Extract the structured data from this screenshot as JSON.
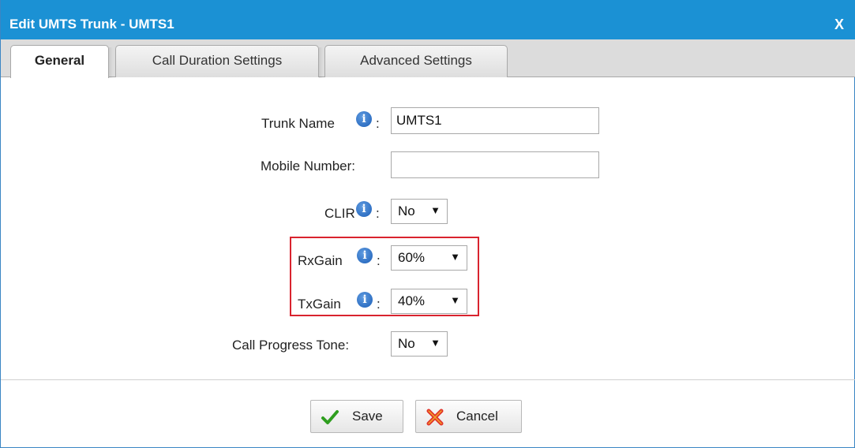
{
  "dialog": {
    "title": "Edit UMTS Trunk - UMTS1",
    "close_label": "X"
  },
  "tabs": [
    {
      "label": "General",
      "active": true
    },
    {
      "label": "Call Duration Settings",
      "active": false
    },
    {
      "label": "Advanced Settings",
      "active": false
    }
  ],
  "form": {
    "trunk_name": {
      "label": "Trunk Name",
      "value": "UMTS1",
      "has_info": true
    },
    "mobile_number": {
      "label": "Mobile Number:",
      "value": ""
    },
    "clir": {
      "label": "CLIR",
      "value": "No",
      "has_info": true
    },
    "rx_gain": {
      "label": "RxGain",
      "value": "60%",
      "has_info": true
    },
    "tx_gain": {
      "label": "TxGain",
      "value": "40%",
      "has_info": true
    },
    "call_progress_tone": {
      "label": "Call Progress Tone:",
      "value": "No"
    },
    "colon": ":"
  },
  "buttons": {
    "save_label": "Save",
    "cancel_label": "Cancel"
  },
  "colors": {
    "titlebar": "#1b91d4",
    "highlight": "#d9232e",
    "info_icon": "#2a6fc9"
  },
  "icons": {
    "info": "info-icon",
    "save": "checkmark-icon",
    "cancel": "cross-icon",
    "select_arrow": "triangle-down-icon"
  }
}
